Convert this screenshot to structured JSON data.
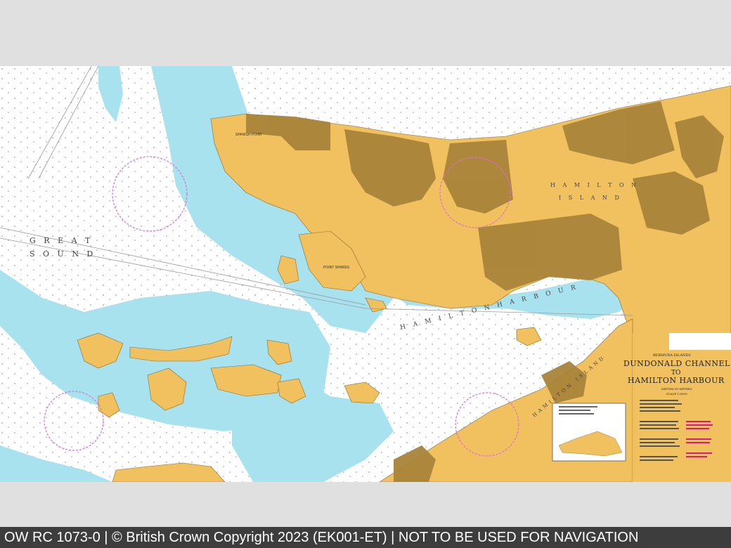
{
  "map": {
    "labels": {
      "great_sound_1": "G R E A T",
      "great_sound_2": "S O U N D",
      "hamilton_harbour": "H A M I L T O N   H A R B O U R",
      "hamilton_island_1": "H A M I L T O N",
      "hamilton_island_2": "I S L A N D",
      "hamilton_island_south": "HAMILTON ISLAND",
      "spanish_point": "SPANISH POINT",
      "point_shares": "POINT SHARES"
    },
    "title_block": {
      "region": "BERMUDA ISLANDS",
      "title_line1": "DUNDONALD CHANNEL",
      "title_line2": "TO",
      "title_line3": "HAMILTON HARBOUR",
      "depths": "DEPTHS IN METRES",
      "scale": "SCALE 1:6000"
    },
    "colors": {
      "land": "#f1c15f",
      "built_up": "#a9843a",
      "shallow_water": "#a8e2ee",
      "deep_water": "#ffffff",
      "compass": "#e06ad8",
      "warning_text": "#e0177c"
    }
  },
  "footer": {
    "text": "OW RC 1073-0 | © British Crown Copyright 2023 (EK001-ET) | NOT TO BE USED FOR NAVIGATION"
  }
}
